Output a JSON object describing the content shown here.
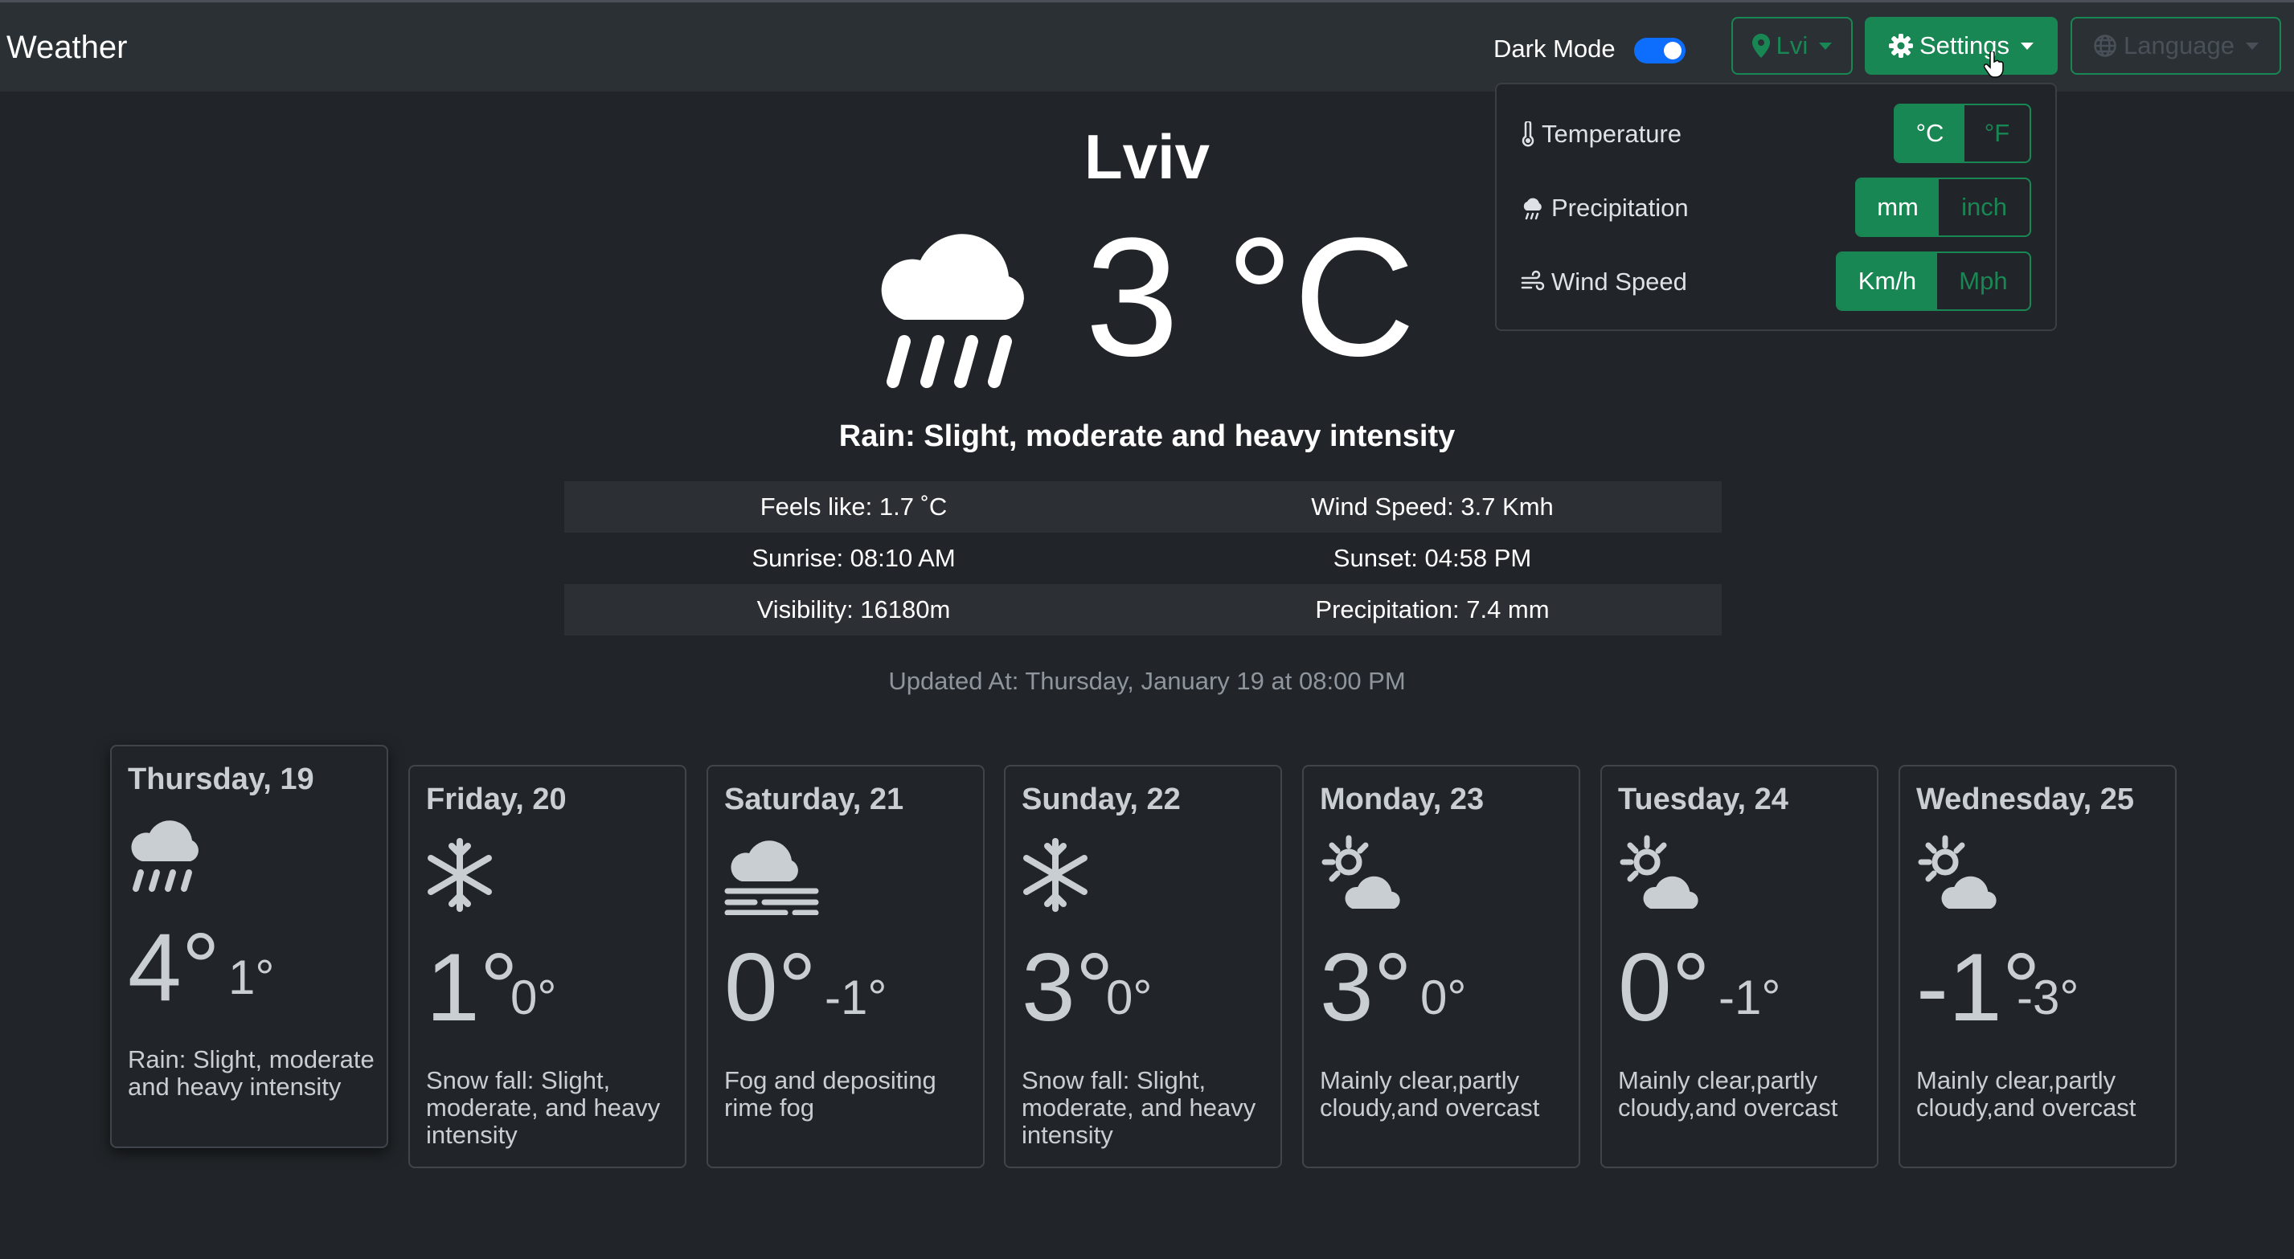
{
  "navbar": {
    "brand": "Weather",
    "dark_mode_label": "Dark Mode",
    "dark_mode_on": true,
    "location_label": "Lvi",
    "settings_label": "Settings",
    "language_label": "Language"
  },
  "settings": {
    "temperature_label": "Temperature",
    "temperature_options": [
      "°C",
      "°F"
    ],
    "temperature_selected": "°C",
    "precipitation_label": "Precipitation",
    "precipitation_options": [
      "mm",
      "inch"
    ],
    "precipitation_selected": "mm",
    "wind_label": "Wind Speed",
    "wind_options": [
      "Km/h",
      "Mph"
    ],
    "wind_selected": "Km/h"
  },
  "current": {
    "city": "Lviv",
    "temperature": "3 °C",
    "icon": "rain-cloud-icon",
    "description": "Rain: Slight, moderate and heavy intensity",
    "feels_like": "Feels like: 1.7 ˚C",
    "wind_speed": "Wind Speed: 3.7 Kmh",
    "sunrise": "Sunrise: 08:10 AM",
    "sunset": "Sunset: 04:58 PM",
    "visibility": "Visibility: 16180m",
    "precipitation": "Precipitation: 7.4 mm",
    "updated": "Updated At: Thursday, January 19 at 08:00 PM"
  },
  "forecast": [
    {
      "day": "Thursday, 19",
      "hi": "4°",
      "lo": "1°",
      "icon": "rain-cloud-icon",
      "desc": "Rain: Slight, moderate and heavy intensity"
    },
    {
      "day": "Friday, 20",
      "hi": "1°",
      "lo": "0°",
      "icon": "snowflake-icon",
      "desc": "Snow fall: Slight, moderate, and heavy intensity"
    },
    {
      "day": "Saturday, 21",
      "hi": "0°",
      "lo": "-1°",
      "icon": "fog-icon",
      "desc": "Fog and depositing rime fog"
    },
    {
      "day": "Sunday, 22",
      "hi": "3°",
      "lo": "0°",
      "icon": "snowflake-icon",
      "desc": "Snow fall: Slight, moderate, and heavy intensity"
    },
    {
      "day": "Monday, 23",
      "hi": "3°",
      "lo": "0°",
      "icon": "partly-cloudy-icon",
      "desc": "Mainly clear,partly cloudy,and overcast"
    },
    {
      "day": "Tuesday, 24",
      "hi": "0°",
      "lo": "-1°",
      "icon": "partly-cloudy-icon",
      "desc": "Mainly clear,partly cloudy,and overcast"
    },
    {
      "day": "Wednesday, 25",
      "hi": "-1°",
      "lo": "-3°",
      "icon": "partly-cloudy-icon",
      "desc": "Mainly clear,partly cloudy,and overcast"
    }
  ],
  "colors": {
    "accent": "#198754",
    "toggle": "#0d6efd",
    "background": "#212529"
  }
}
